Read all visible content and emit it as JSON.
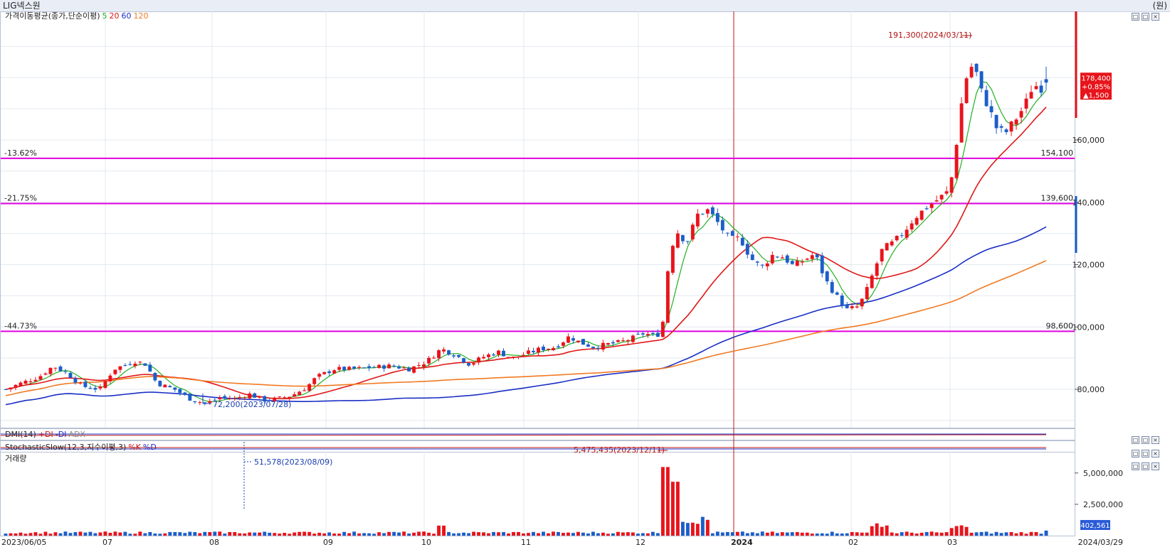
{
  "window": {
    "title": "LIG넥스원",
    "unit": "(원)"
  },
  "panels": {
    "price_legend": {
      "name": "가격이동평균(종가,단순이평)",
      "ma5": "5",
      "ma20": "20",
      "ma60": "60",
      "ma120": "120"
    },
    "dmi_legend": {
      "name": "DMI(14)",
      "plus_di": "+DI",
      "minus_di": "-DI",
      "adx": "ADX"
    },
    "stoch_legend": {
      "name": "StochasticSlow(12,3,지수이평,3)",
      "k": "%K",
      "d": "%D"
    },
    "volume_legend": {
      "name": "거래량"
    }
  },
  "colors": {
    "up": "#e8141b",
    "down": "#1b5ec9",
    "ma5": "#22b022",
    "ma20": "#e01818",
    "ma60": "#1a2fc4",
    "ma120": "#f07a22",
    "level_line": "#e000e0",
    "current_price_bg": "#e8141b"
  },
  "chart_data": [
    {
      "type": "candlestick",
      "title": "LIG넥스원",
      "xlabel": "",
      "ylabel": "",
      "ylim": [
        62500,
        212000
      ],
      "yticks": [
        80000,
        100000,
        120000,
        140000,
        160000
      ],
      "ytick_labels": [
        "80,000",
        "100,000",
        "120,000",
        "140,000",
        "160,000"
      ],
      "x_start": "2023/06/05",
      "x_end": "2024/03/29",
      "month_labels": [
        "07",
        "08",
        "09",
        "10",
        "11",
        "12",
        "2024",
        "02",
        "03"
      ],
      "annotations": {
        "high": "191,300(2024/03/11)",
        "low": "72,200(2023/07/28)",
        "current_price": "178,400",
        "current_change_pct": "+0.85%",
        "current_change": "▲1,500"
      },
      "levels": [
        {
          "pct": "-13.62%",
          "price": 154100,
          "label": "154,100"
        },
        {
          "pct": "-21.75%",
          "price": 139600,
          "label": "139,600"
        },
        {
          "pct": "-44.73%",
          "price": 98600,
          "label": "98,600"
        }
      ],
      "series": [
        {
          "name": "5",
          "type": "line"
        },
        {
          "name": "20",
          "type": "line"
        },
        {
          "name": "60",
          "type": "line"
        },
        {
          "name": "120",
          "type": "line"
        }
      ]
    },
    {
      "type": "bar",
      "title": "거래량",
      "yticks": [
        2500000,
        5000000
      ],
      "ytick_labels": [
        "2,500,000",
        "5,000,000"
      ],
      "ylim": [
        0,
        6000000
      ],
      "annotations": {
        "max": "5,475,435(2023/12/11)",
        "min": "51,578(2023/08/09)",
        "current": "402,561"
      }
    }
  ]
}
